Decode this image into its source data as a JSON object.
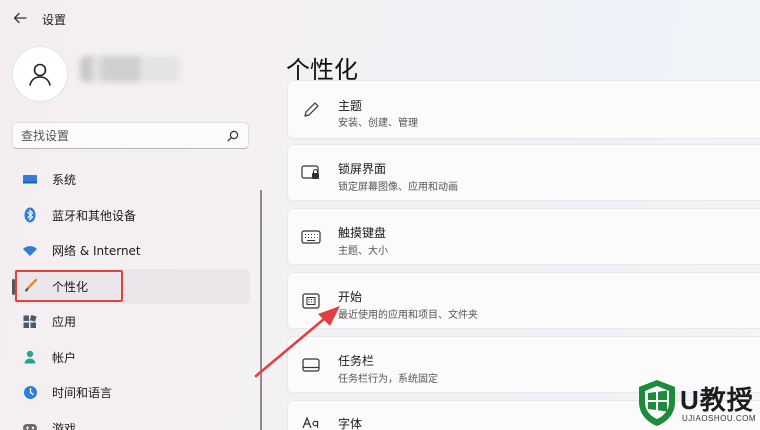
{
  "app": {
    "title": "设置"
  },
  "search": {
    "placeholder": "查找设置"
  },
  "sidebar": {
    "items": [
      {
        "label": "系统",
        "icon": "monitor-icon"
      },
      {
        "label": "蓝牙和其他设备",
        "icon": "bluetooth-icon"
      },
      {
        "label": "网络 & Internet",
        "icon": "wifi-icon"
      },
      {
        "label": "个性化",
        "icon": "brush-icon",
        "selected": true
      },
      {
        "label": "应用",
        "icon": "apps-icon"
      },
      {
        "label": "帐户",
        "icon": "person-icon"
      },
      {
        "label": "时间和语言",
        "icon": "globe-clock-icon"
      },
      {
        "label": "游戏",
        "icon": "gamepad-icon"
      }
    ]
  },
  "main": {
    "title": "个性化",
    "cards": [
      {
        "title": "主题",
        "subtitle": "安装、创建、管理",
        "icon": "pen-icon"
      },
      {
        "title": "锁屏界面",
        "subtitle": "锁定屏幕图像、应用和动画",
        "icon": "lock-screen-icon"
      },
      {
        "title": "触摸键盘",
        "subtitle": "主题、大小",
        "icon": "keyboard-icon"
      },
      {
        "title": "开始",
        "subtitle": "最近使用的应用和项目、文件夹",
        "icon": "start-menu-icon"
      },
      {
        "title": "任务栏",
        "subtitle": "任务栏行为，系统固定",
        "icon": "taskbar-icon"
      },
      {
        "title": "字体",
        "subtitle": "",
        "icon": "font-icon"
      }
    ]
  },
  "watermark": {
    "brand": "U教授",
    "domain": "UJIAOSHOU.COM"
  },
  "colors": {
    "annotation": "#e04040",
    "watermark_green": "#1e8a3c"
  }
}
